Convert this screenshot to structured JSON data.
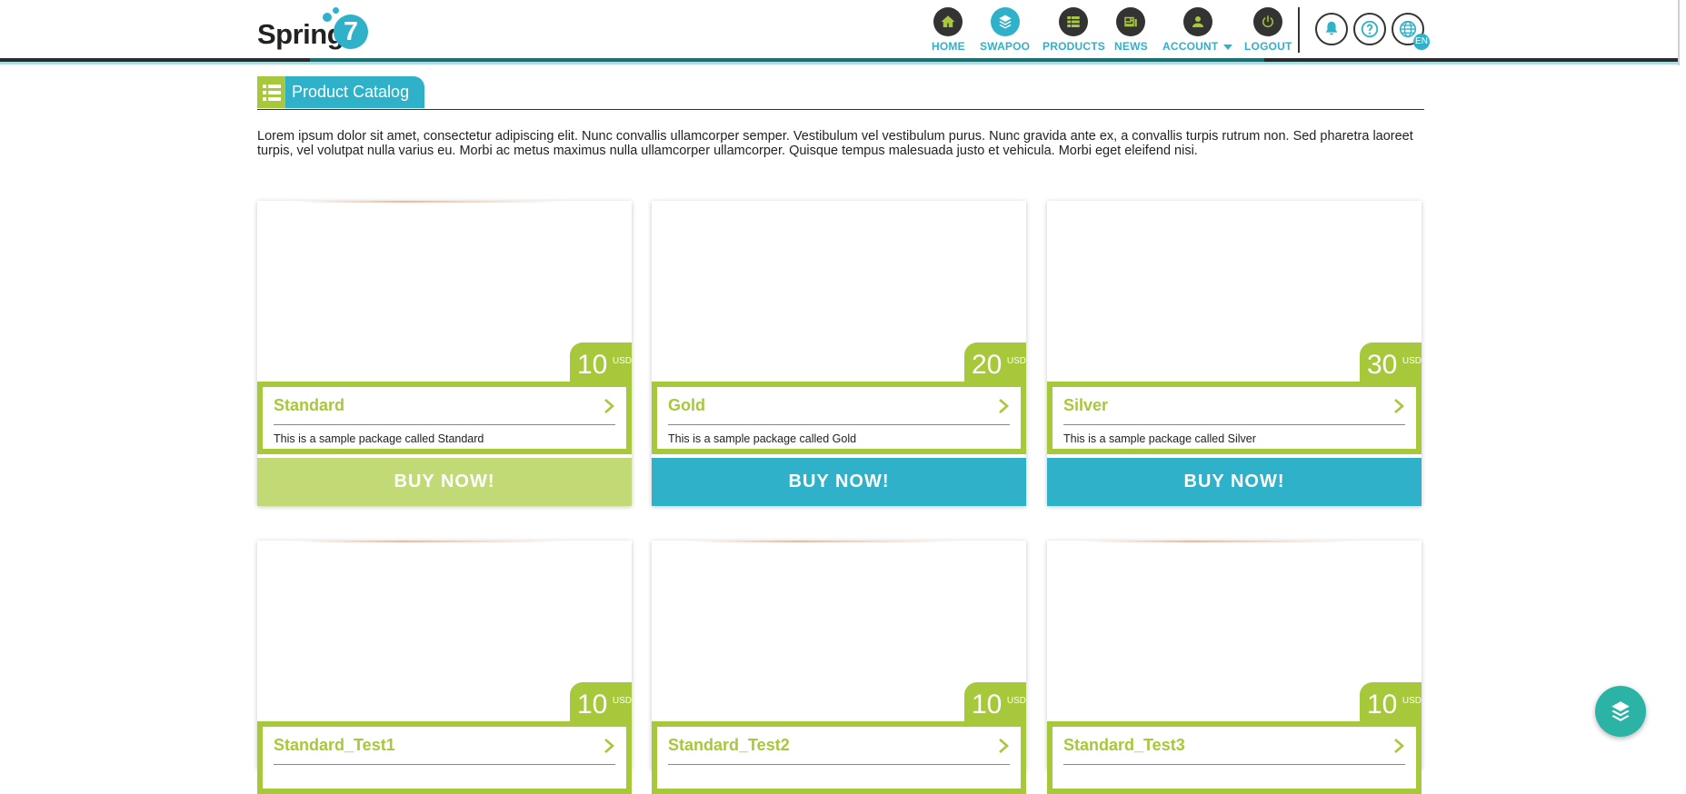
{
  "brand": {
    "name": "Spring",
    "badge": "7"
  },
  "nav": [
    {
      "label": "HOME",
      "icon": "home-icon"
    },
    {
      "label": "SWAPOO",
      "icon": "swapoo-icon"
    },
    {
      "label": "PRODUCTS",
      "icon": "grid-icon"
    },
    {
      "label": "NEWS",
      "icon": "newspaper-icon"
    },
    {
      "label": "ACCOUNT",
      "icon": "person-icon"
    },
    {
      "label": "LOGOUT",
      "icon": "power-icon"
    }
  ],
  "header_buttons": {
    "language": "EN"
  },
  "section": {
    "title": "Product Catalog"
  },
  "intro": "Lorem ipsum dolor sit amet, consectetur adipiscing elit. Nunc convallis ullamcorper semper. Vestibulum vel vestibulum purus. Nunc gravida ante ex, a convallis turpis rutrum non. Sed pharetra laoreet turpis, vel volutpat nulla varius eu. Morbi ac metus maximus nulla ullamcorper ullamcorper. Quisque tempus malesuada justo et vehicula. Morbi eget eleifend nisi.",
  "products": [
    {
      "name": "Standard",
      "price": "10",
      "currency": "USD",
      "description": "This is a sample package called Standard",
      "buy_label": "BUY NOW!"
    },
    {
      "name": "Gold",
      "price": "20",
      "currency": "USD",
      "description": "This is a sample package called Gold",
      "buy_label": "BUY NOW!"
    },
    {
      "name": "Silver",
      "price": "30",
      "currency": "USD",
      "description": "This is a sample package called Silver",
      "buy_label": "BUY NOW!"
    },
    {
      "name": "Standard_Test1",
      "price": "10",
      "currency": "USD"
    },
    {
      "name": "Standard_Test2",
      "price": "10",
      "currency": "USD"
    },
    {
      "name": "Standard_Test3",
      "price": "10",
      "currency": "USD"
    }
  ],
  "colors": {
    "accent": "#2fb1c9",
    "green": "#a6c83a",
    "buy_disabled": "#c1da76",
    "dark": "#333333"
  }
}
